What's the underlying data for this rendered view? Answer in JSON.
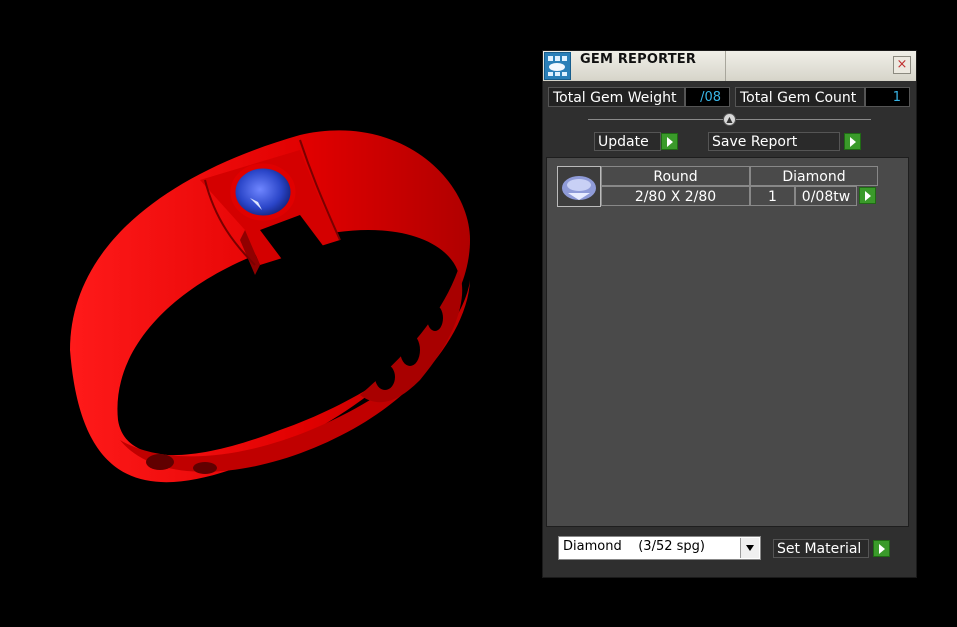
{
  "panel": {
    "title": "GEM REPORTER",
    "close_glyph": "×"
  },
  "stats": {
    "total_gem_weight_label": "Total Gem Weight",
    "total_gem_weight_value": "/08",
    "total_gem_count_label": "Total Gem Count",
    "total_gem_count_value": "1"
  },
  "actions": {
    "update_label": "Update",
    "save_report_label": "Save Report"
  },
  "report": {
    "rows": [
      {
        "shape": "Round",
        "material": "Diamond",
        "size": "2/80 X 2/80",
        "count": "1",
        "weight": "0/08tw"
      }
    ]
  },
  "material": {
    "selected": "Diamond    (3/52 spg)",
    "set_label": "Set Material"
  },
  "colors": {
    "ring": "#e00000",
    "gem": "#2a45c8",
    "accent_button": "#3a9a2a",
    "value_text": "#39b5e6"
  }
}
